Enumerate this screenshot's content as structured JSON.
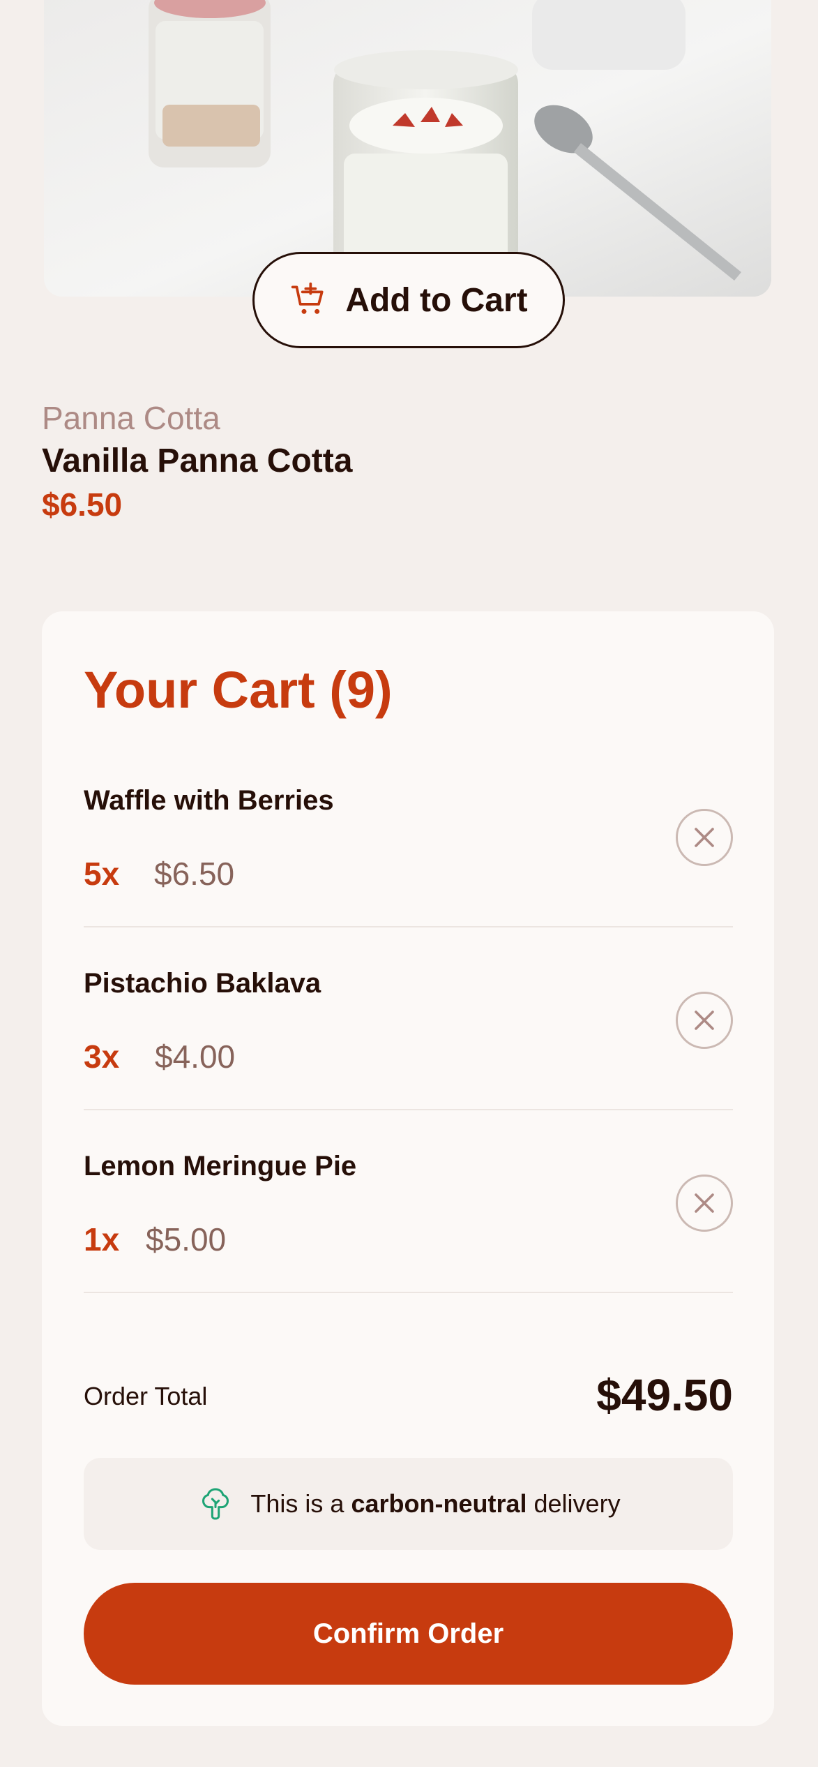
{
  "product": {
    "image_alt": "Vanilla Panna Cotta",
    "add_to_cart_label": "Add to Cart",
    "category": "Panna Cotta",
    "name": "Vanilla Panna Cotta",
    "price": "$6.50"
  },
  "cart": {
    "title": "Your Cart (9)",
    "items": [
      {
        "name": "Waffle with Berries",
        "qty": "5x",
        "price": "$6.50"
      },
      {
        "name": "Pistachio Baklava",
        "qty": "3x",
        "price": "$4.00"
      },
      {
        "name": "Lemon Meringue Pie",
        "qty": "1x",
        "price": "$5.00"
      }
    ],
    "order_total_label": "Order Total",
    "order_total_value": "$49.50",
    "carbon_prefix": "This is a ",
    "carbon_bold": "carbon-neutral",
    "carbon_suffix": " delivery",
    "confirm_label": "Confirm Order"
  },
  "colors": {
    "accent": "#c73b0f",
    "text": "#260f08",
    "muted": "#87635a",
    "background": "#f4efec",
    "panel": "#fcf9f7",
    "green": "#1ea475"
  },
  "icons": {
    "add_to_cart": "cart-plus-icon",
    "remove": "close-icon",
    "carbon": "tree-icon"
  }
}
